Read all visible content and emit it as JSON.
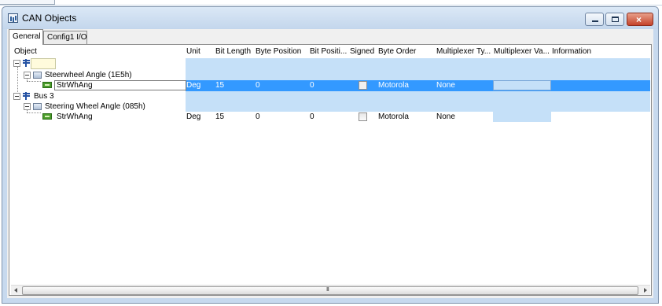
{
  "window": {
    "title": "CAN Objects",
    "icon": "can-objects-icon",
    "controls": {
      "minimize": "minimize-icon",
      "maximize": "maximize-icon",
      "close": "×"
    }
  },
  "tabs": [
    {
      "label": "General",
      "active": true
    },
    {
      "label": "Config1 I/O",
      "active": false
    }
  ],
  "columns": [
    "Object",
    "Unit",
    "Bit Length",
    "Byte Position",
    "Bit Positi...",
    "Signed",
    "Byte Order",
    "Multiplexer Ty...",
    "Multiplexer Va...",
    "Information"
  ],
  "tree": [
    {
      "type": "bus",
      "label": "",
      "editing": true
    },
    {
      "type": "message",
      "label": "Steerwheel Angle (1E5h)"
    },
    {
      "type": "signal",
      "label": "StrWhAng",
      "unit": "Deg",
      "bit_length": "15",
      "byte_position": "0",
      "bit_position": "0",
      "signed": false,
      "byte_order": "Motorola",
      "mux_type": "None",
      "mux_value": "",
      "information": "",
      "selected": true
    },
    {
      "type": "bus",
      "label": "Bus  3"
    },
    {
      "type": "message",
      "label": "Steering Wheel Angle (085h)"
    },
    {
      "type": "signal",
      "label": "StrWhAng",
      "unit": "Deg",
      "bit_length": "15",
      "byte_position": "0",
      "bit_position": "0",
      "signed": false,
      "byte_order": "Motorola",
      "mux_type": "None",
      "mux_value": "",
      "information": "",
      "selected": false
    }
  ],
  "scrollbar": {
    "grip": "III"
  },
  "colors": {
    "selection": "#3399ff",
    "shade": "#c5e0f8",
    "edit_box": "#fffbdc",
    "signal_icon": "#4a9c2b",
    "bus_icon": "#2552a3"
  }
}
